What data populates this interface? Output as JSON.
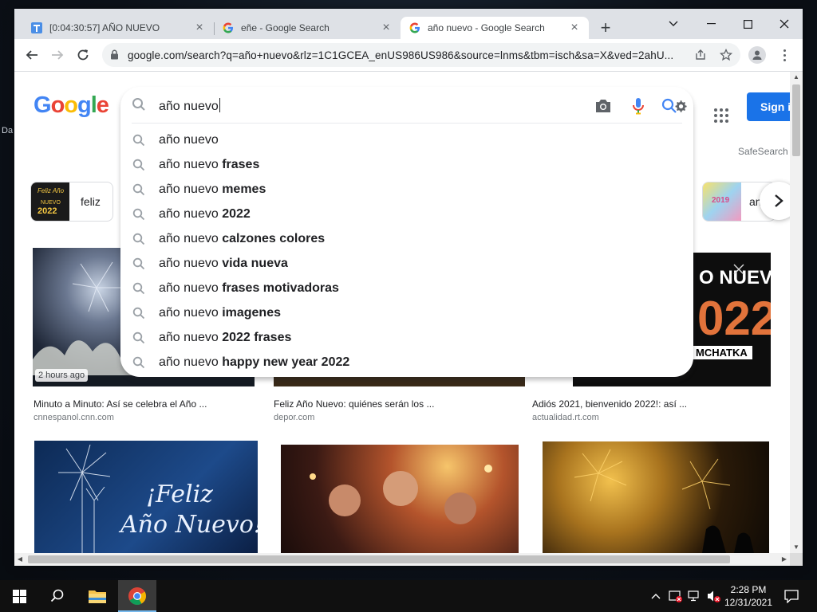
{
  "browser": {
    "tabs": [
      {
        "title": "[0:04:30:57] AÑO NUEVO",
        "icon": "t-app-icon"
      },
      {
        "title": "eñe - Google Search",
        "icon": "google-g-icon"
      },
      {
        "title": "año nuevo - Google Search",
        "icon": "google-g-icon",
        "active": true
      }
    ],
    "new_tab": "+",
    "url": "google.com/search?q=año+nuevo&rlz=1C1GCEA_enUS986US986&source=lnms&tbm=isch&sa=X&ved=2ahU..."
  },
  "google": {
    "logo_letters": [
      "G",
      "o",
      "o",
      "g",
      "l",
      "e"
    ],
    "logo_colors": [
      "#4285F4",
      "#EA4335",
      "#FBBC05",
      "#4285F4",
      "#34A853",
      "#EA4335"
    ],
    "sign_in": "Sign i",
    "safesearch": "SafeSearch",
    "query": "año nuevo",
    "suggestions": [
      {
        "base": "año nuevo",
        "bold": ""
      },
      {
        "base": "año nuevo",
        "bold": "frases"
      },
      {
        "base": "año nuevo",
        "bold": "memes"
      },
      {
        "base": "año nuevo",
        "bold": "2022"
      },
      {
        "base": "año nuevo",
        "bold": "calzones colores"
      },
      {
        "base": "año nuevo",
        "bold": "vida nueva"
      },
      {
        "base": "año nuevo",
        "bold": "frases motivadoras"
      },
      {
        "base": "año nuevo",
        "bold": "imagenes"
      },
      {
        "base": "año nuevo",
        "bold": "2022 frases"
      },
      {
        "base": "año nuevo",
        "bold": "happy new year 2022"
      }
    ],
    "chips": [
      {
        "label": "feliz"
      },
      {
        "label": "an"
      }
    ],
    "chip_year": "2019",
    "chip_img_text": [
      "Feliz Año",
      "NUEVO",
      "2022"
    ],
    "results": [
      {
        "title": "Minuto a Minuto: Así se celebra el Año ...",
        "source": "cnnespanol.cnn.com",
        "badge": "2 hours ago"
      },
      {
        "title": "Feliz Año Nuevo: quiénes serán los ...",
        "source": "depor.com"
      },
      {
        "title": "Adiós 2021, bienvenido 2022!: así ...",
        "source": "actualidad.rt.com"
      }
    ],
    "overlay_text": [
      "O NUEVO",
      "022",
      "MCHATKA"
    ],
    "image_text": [
      "¡Feliz",
      "Año Nuevo!"
    ]
  },
  "taskbar": {
    "time": "2:28 PM",
    "date": "12/31/2021"
  },
  "desktop": {
    "label": "Da"
  }
}
